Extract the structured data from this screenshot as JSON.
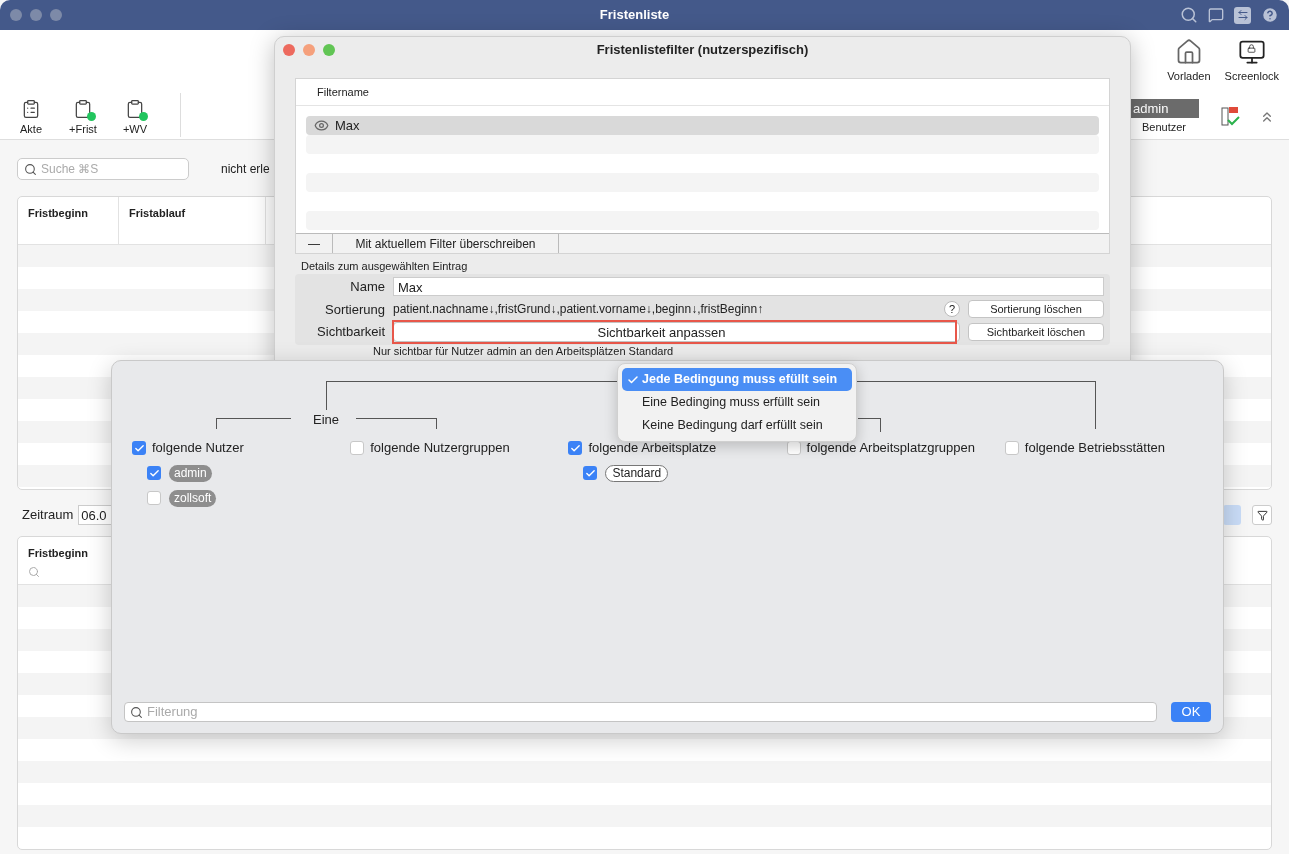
{
  "window": {
    "title": "Fristenliste"
  },
  "toolbar": {
    "left": [
      {
        "label": "Akte"
      },
      {
        "label": "+Frist"
      },
      {
        "label": "+WV"
      }
    ],
    "right": [
      {
        "label": "Vorladen"
      },
      {
        "label": "Screenlock"
      }
    ],
    "user": {
      "name": "admin",
      "label": "Benutzer"
    }
  },
  "search": {
    "placeholder": "Suche ⌘S"
  },
  "status_filter": "nicht erle",
  "table_top": {
    "columns": [
      "Fristbeginn",
      "Fristablauf"
    ]
  },
  "period": {
    "label": "Zeitraum",
    "value": "06.0"
  },
  "table_bottom": {
    "columns": [
      "Fristbeginn"
    ]
  },
  "dialog": {
    "title": "Fristenlistefilter (nutzerspezifisch)",
    "filter_table": {
      "column": "Filtername",
      "rows": [
        {
          "name": "Max",
          "selected": true
        }
      ],
      "remove_button": "—",
      "overwrite_button": "Mit aktuellem Filter überschreiben"
    },
    "details": {
      "title": "Details zum ausgewählten Eintrag",
      "name_label": "Name",
      "name_value": "Max",
      "sort_label": "Sortierung",
      "sort_value": "patient.nachname↓,fristGrund↓,patient.vorname↓,beginn↓,fristBeginn↑",
      "help_button": "?",
      "sort_clear_button": "Sortierung löschen",
      "visibility_label": "Sichtbarkeit",
      "visibility_button": "Sichtbarkeit anpassen",
      "visibility_clear_button": "Sichtbarkeit löschen",
      "visibility_note": "Nur sichtbar für Nutzer admin an den Arbeitsplätzen Standard"
    }
  },
  "visibility_popover": {
    "group_label": "Eine",
    "columns": [
      {
        "label": "folgende Nutzer",
        "checked": true,
        "children": [
          {
            "label": "admin",
            "checked": true,
            "kind": "user"
          },
          {
            "label": "zollsoft",
            "checked": false,
            "kind": "user"
          }
        ]
      },
      {
        "label": "folgende Nutzergruppen",
        "checked": false
      },
      {
        "label": "folgende Arbeitsplatze",
        "checked": true,
        "children": [
          {
            "label": "Standard",
            "checked": true,
            "kind": "workstation"
          }
        ]
      },
      {
        "label": "folgende Arbeitsplatzgruppen",
        "checked": false
      },
      {
        "label": "folgende Betriebsstätten",
        "checked": false
      }
    ],
    "filter": {
      "placeholder": "Filterung"
    },
    "ok_button": "OK"
  },
  "condition_menu": {
    "items": [
      {
        "label": "Jede Bedingung muss efüllt sein",
        "selected": true
      },
      {
        "label": "Eine Bedinging muss erfüllt sein",
        "selected": false
      },
      {
        "label": "Keine Bedingung darf erfüllt sein",
        "selected": false
      }
    ]
  }
}
